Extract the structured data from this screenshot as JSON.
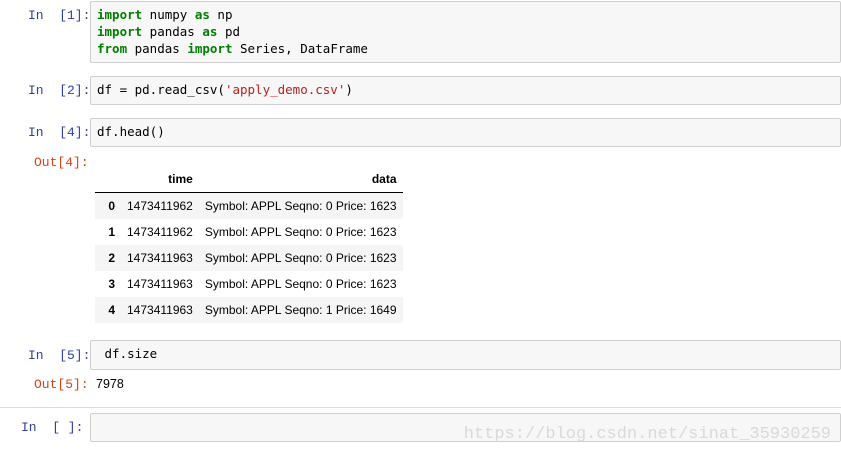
{
  "cells": {
    "c1": {
      "prompt": "In  [1]:",
      "lines": [
        [
          {
            "t": "import",
            "c": "kw"
          },
          {
            "t": " numpy ",
            "c": ""
          },
          {
            "t": "as",
            "c": "kw"
          },
          {
            "t": " np",
            "c": ""
          }
        ],
        [
          {
            "t": "import",
            "c": "kw"
          },
          {
            "t": " pandas ",
            "c": ""
          },
          {
            "t": "as",
            "c": "kw"
          },
          {
            "t": " pd",
            "c": ""
          }
        ],
        [
          {
            "t": "from",
            "c": "kw"
          },
          {
            "t": " pandas ",
            "c": ""
          },
          {
            "t": "import",
            "c": "kw"
          },
          {
            "t": " Series, DataFrame",
            "c": ""
          }
        ]
      ]
    },
    "c2": {
      "prompt": "In  [2]:",
      "lines": [
        [
          {
            "t": "df = pd.read_csv(",
            "c": ""
          },
          {
            "t": "'apply_demo.csv'",
            "c": "str"
          },
          {
            "t": ")",
            "c": ""
          }
        ]
      ]
    },
    "c4": {
      "prompt": "In  [4]:",
      "lines": [
        [
          {
            "t": "df.head()",
            "c": ""
          }
        ]
      ],
      "out_prompt": "Out[4]:",
      "table": {
        "columns": [
          "",
          "time",
          "data"
        ],
        "rows": [
          {
            "index": "0",
            "time": "1473411962",
            "data": "Symbol: APPL Seqno: 0 Price: 1623"
          },
          {
            "index": "1",
            "time": "1473411962",
            "data": "Symbol: APPL Seqno: 0 Price: 1623"
          },
          {
            "index": "2",
            "time": "1473411963",
            "data": "Symbol: APPL Seqno: 0 Price: 1623"
          },
          {
            "index": "3",
            "time": "1473411963",
            "data": "Symbol: APPL Seqno: 0 Price: 1623"
          },
          {
            "index": "4",
            "time": "1473411963",
            "data": "Symbol: APPL Seqno: 1 Price: 1649"
          }
        ]
      }
    },
    "c5": {
      "prompt": "In  [5]:",
      "lines": [
        [
          {
            "t": " df.size",
            "c": ""
          }
        ]
      ],
      "out_prompt": "Out[5]:",
      "output": "7978"
    },
    "c6": {
      "prompt": "In  [ ]:",
      "lines": []
    }
  },
  "watermark": "https://blog.csdn.net/sinat_35930259",
  "colors": {
    "in_prompt": "#303f9f",
    "out_prompt": "#d84315",
    "keyword": "#008000",
    "string": "#ba2121",
    "cell_bg": "#f7f7f7",
    "cell_border": "#cfcfcf"
  }
}
